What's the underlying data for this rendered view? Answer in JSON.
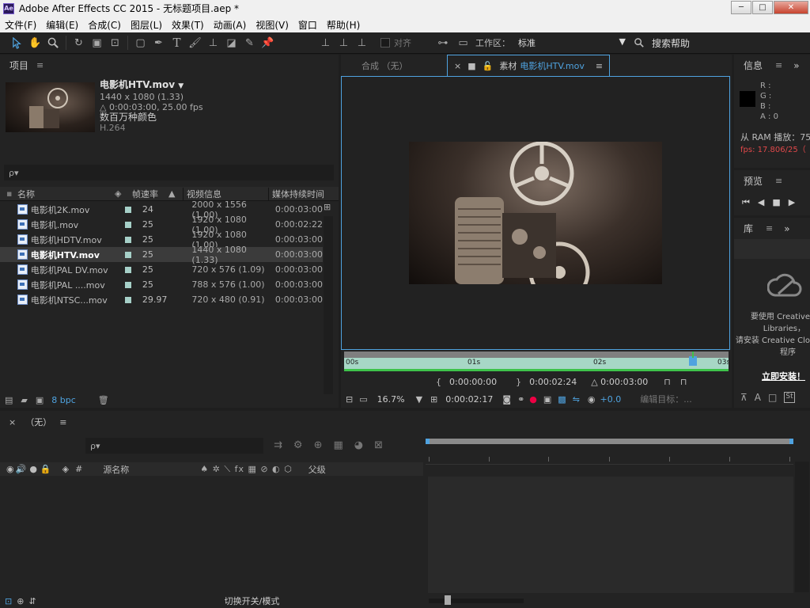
{
  "window": {
    "title": "Adobe After Effects CC 2015 - 无标题项目.aep *",
    "logo": "Ae",
    "min": "─",
    "max": "□",
    "close": "✕"
  },
  "menu": [
    "文件(F)",
    "编辑(E)",
    "合成(C)",
    "图层(L)",
    "效果(T)",
    "动画(A)",
    "视图(V)",
    "窗口",
    "帮助(H)"
  ],
  "toolbar": {
    "align_label": "对齐",
    "workspace_label": "工作区：",
    "workspace_value": "标准",
    "search_help": "搜索帮助"
  },
  "project": {
    "tab": "项目",
    "selected": {
      "name": "电影机HTV.mov",
      "dims": "1440 x 1080 (1.33)",
      "duration": "△ 0:00:03:00, 25.00 fps",
      "color": "数百万种颜色",
      "codec": "H.264"
    },
    "search_placeholder": "ρ▾",
    "columns": [
      "名称",
      "帧速率",
      "视频信息",
      "媒体持续时间"
    ],
    "files": [
      {
        "name": "电影机2K.mov",
        "fps": "24",
        "info": "2000 x 1556 (1.00)",
        "dur": "0:00:03:00"
      },
      {
        "name": "电影机.mov",
        "fps": "25",
        "info": "1920 x 1080 (1.00)",
        "dur": "0:00:02:22"
      },
      {
        "name": "电影机HDTV.mov",
        "fps": "25",
        "info": "1920 x 1080 (1.00)",
        "dur": "0:00:03:00"
      },
      {
        "name": "电影机HTV.mov",
        "fps": "25",
        "info": "1440 x 1080 (1.33)",
        "dur": "0:00:03:00"
      },
      {
        "name": "电影机PAL DV.mov",
        "fps": "25",
        "info": "720 x 576 (1.09)",
        "dur": "0:00:03:00"
      },
      {
        "name": "电影机PAL ....mov",
        "fps": "25",
        "info": "788 x 576 (1.00)",
        "dur": "0:00:03:00"
      },
      {
        "name": "电影机NTSC...mov",
        "fps": "29.97",
        "info": "720 x 480 (0.91)",
        "dur": "0:00:03:00"
      }
    ],
    "bpc": "8 bpc"
  },
  "viewer": {
    "tab_comp": "合成 （无）",
    "tab_footage_prefix": "素材",
    "tab_footage_name": "电影机HTV.mov",
    "ruler": [
      "00s",
      "01s",
      "02s",
      "03s"
    ],
    "in_point": "0:00:00:00",
    "out_point": "0:00:02:24",
    "duration": "△ 0:00:03:00",
    "zoom": "16.7%",
    "timecode": "0:00:02:17",
    "exposure": "+0.0",
    "edit_target": "编辑目标：..."
  },
  "info": {
    "tab": "信息",
    "r": "R :",
    "g": "G :",
    "b": "B :",
    "a": "A : 0",
    "ram": "从 RAM 播放：75",
    "fps": "fps: 17.806/25（"
  },
  "preview": {
    "tab": "预览"
  },
  "library": {
    "tab": "库",
    "msg1": "要使用 Creative",
    "msg2": "Libraries，",
    "msg3": "请安装 Creative Clo",
    "msg4": "程序",
    "install": "立即安装！"
  },
  "timeline": {
    "tab": "（无）",
    "search_placeholder": "ρ▾",
    "col_source": "源名称",
    "col_parent": "父级",
    "hash": "#",
    "toggle": "切换开关/模式"
  }
}
